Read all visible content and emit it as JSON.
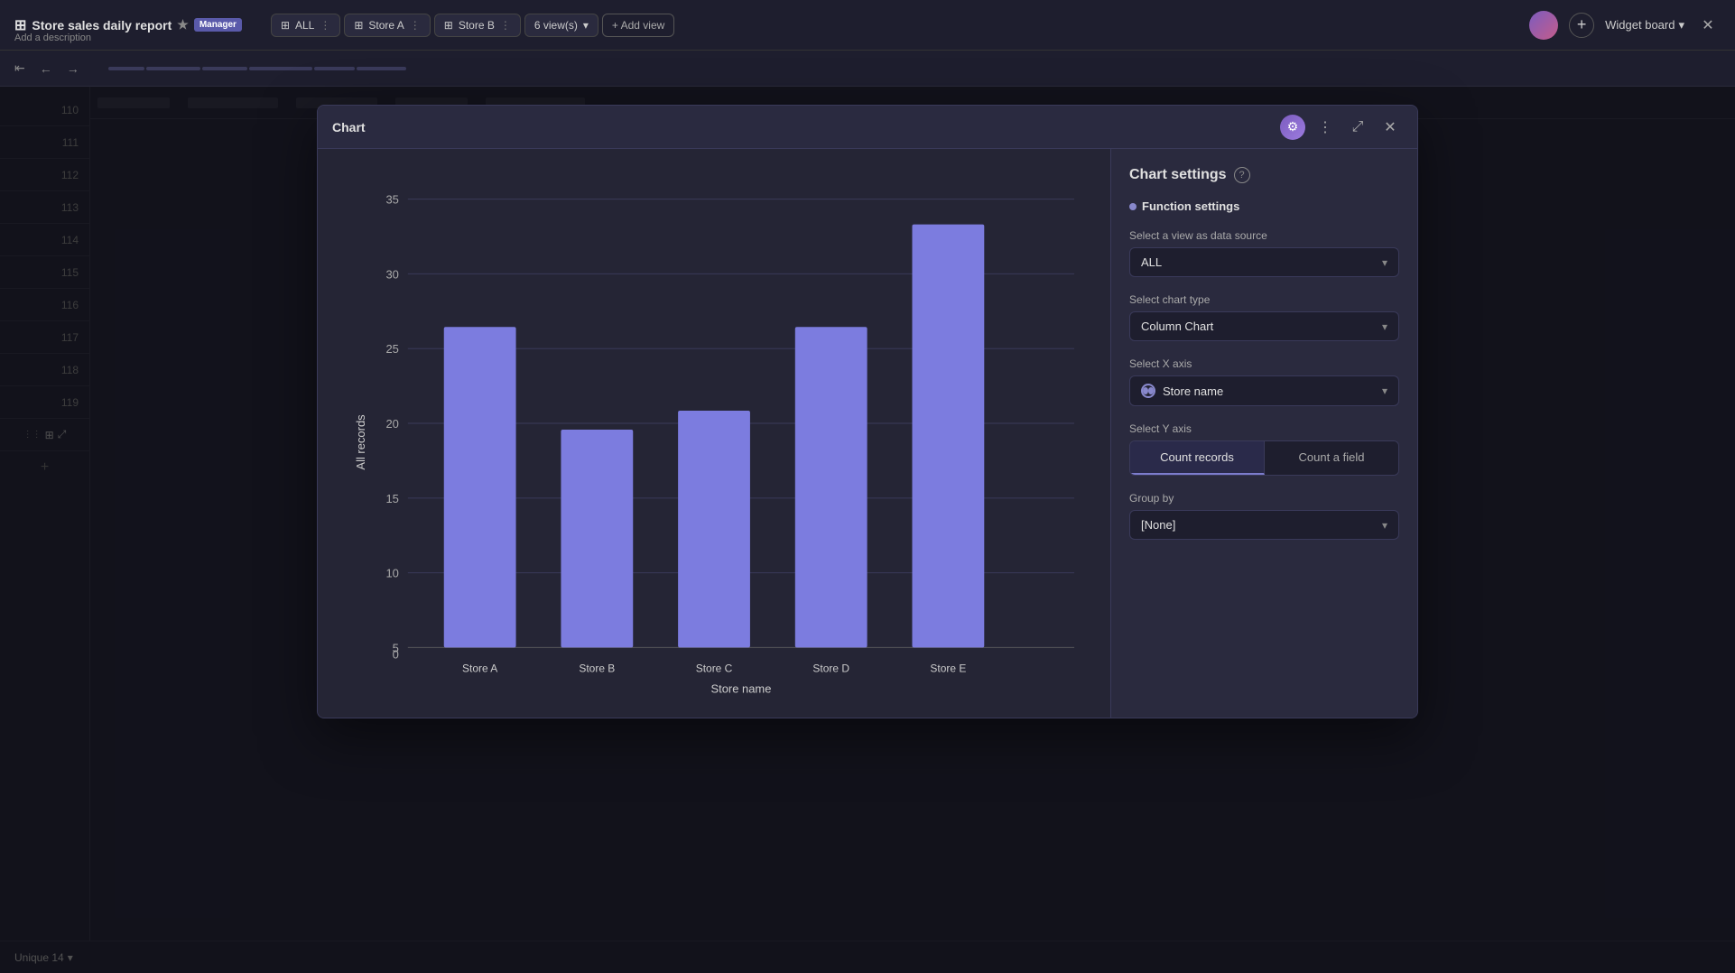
{
  "app": {
    "title": "Store sales daily report",
    "badge": "Manager",
    "description": "Add a description",
    "widget_board": "Widget board",
    "plus_icon": "+",
    "close_icon": "✕"
  },
  "tabs": [
    {
      "id": "all",
      "label": "ALL",
      "icon": "⊞"
    },
    {
      "id": "store-a",
      "label": "Store A",
      "icon": "⊞"
    },
    {
      "id": "store-b",
      "label": "Store B",
      "icon": "⊞"
    }
  ],
  "views": {
    "label": "6 view(s)",
    "add_label": "+ Add view"
  },
  "second_bar": {
    "arrows": [
      "←",
      "→"
    ]
  },
  "row_numbers": [
    110,
    111,
    112,
    113,
    114,
    115,
    116,
    117,
    118,
    119
  ],
  "chart_modal": {
    "title": "Chart",
    "settings_title": "Chart settings",
    "function_settings": "Function settings",
    "data_source_label": "Select a view as data source",
    "data_source_value": "ALL",
    "chart_type_label": "Select chart type",
    "chart_type_value": "Column Chart",
    "x_axis_label": "Select X axis",
    "x_axis_value": "Store name",
    "y_axis_label": "Select Y axis",
    "y_axis_btn1": "Count records",
    "y_axis_btn2": "Count a field",
    "group_by_label": "Group by",
    "group_by_value": "[None]",
    "chart": {
      "y_axis_label": "All records",
      "x_axis_label": "Store name",
      "bars": [
        {
          "label": "Store A",
          "value": 25
        },
        {
          "label": "Store B",
          "value": 17
        },
        {
          "label": "Store C",
          "value": 18.5
        },
        {
          "label": "Store D",
          "value": 25
        },
        {
          "label": "Store E",
          "value": 33
        }
      ],
      "y_max": 35,
      "y_ticks": [
        0,
        5,
        10,
        15,
        20,
        25,
        30,
        35
      ],
      "bar_color": "#7c7cdf"
    }
  },
  "bottom_bar": {
    "unique_label": "Unique 14"
  },
  "icons": {
    "star": "★",
    "settings": "⚙",
    "more": "⋮",
    "expand": "⤢",
    "close": "✕",
    "dropdown_arrow": "⌄",
    "chevron_down": "▾",
    "nav_back": "←",
    "nav_forward": "→",
    "nav_home": "⇤",
    "help": "?",
    "radio_active": "●"
  }
}
